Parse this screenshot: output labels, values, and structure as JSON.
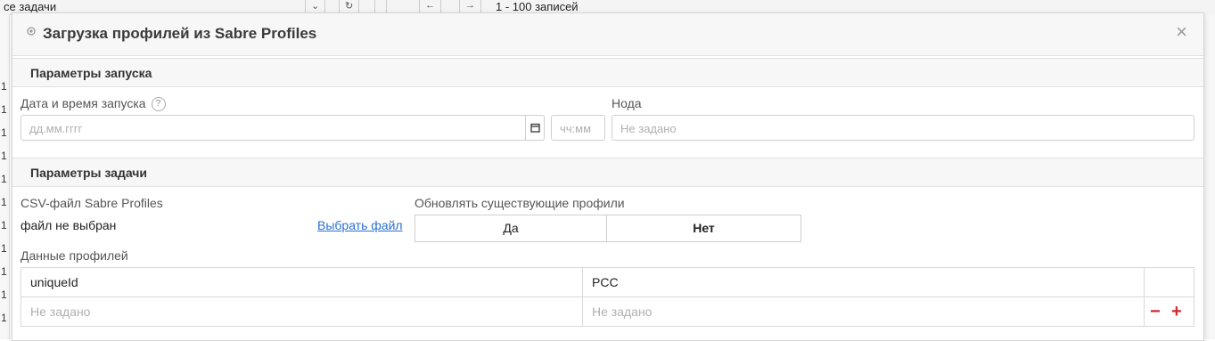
{
  "background": {
    "breadcrumb": "се задачи",
    "records_label": "1 - 100 записей",
    "row_numbers": [
      "1",
      "1",
      "1",
      "1",
      "1",
      "1",
      "1",
      "1",
      "1",
      "1",
      "1"
    ]
  },
  "dialog": {
    "title": "Загрузка профилей из Sabre Profiles",
    "close_glyph": "×",
    "launch_section": {
      "title": "Параметры запуска",
      "date_label": "Дата и время запуска",
      "help_glyph": "?",
      "date_placeholder": "дд.мм.гггг",
      "time_placeholder": "чч:мм",
      "node_label": "Нода",
      "node_placeholder": "Не задано"
    },
    "task_section": {
      "title": "Параметры задачи",
      "csv_label": "CSV-файл Sabre Profiles",
      "file_status": "файл не выбран",
      "choose_file": "Выбрать файл",
      "update_label": "Обновлять существующие профили",
      "toggle_yes": "Да",
      "toggle_no": "Нет",
      "toggle_selected": "Нет",
      "profiles_label": "Данные профилей",
      "table": {
        "headers": [
          "uniqueId",
          "PCC"
        ],
        "placeholders": [
          "Не задано",
          "Не задано"
        ]
      },
      "remove_glyph": "−",
      "add_glyph": "+"
    }
  },
  "colors": {
    "accent_link": "#2a6fd1",
    "action_red": "#d0272f"
  }
}
